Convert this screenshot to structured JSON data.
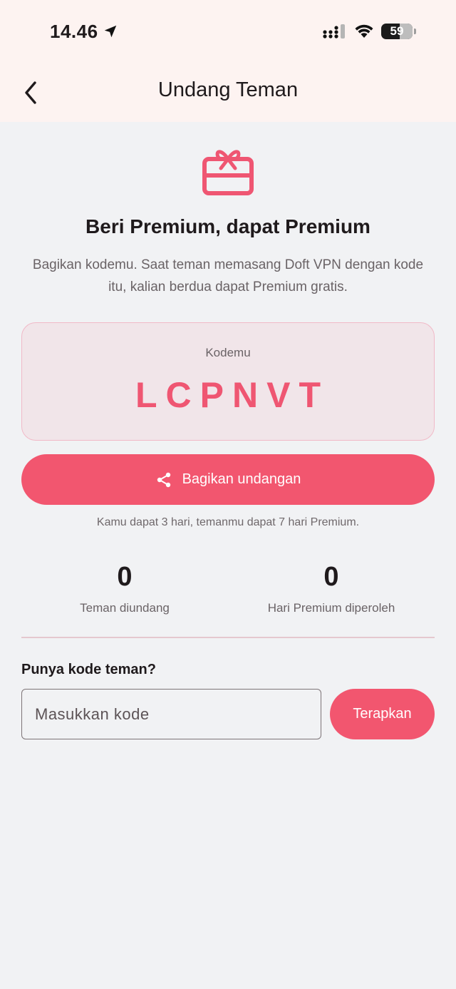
{
  "status_bar": {
    "time": "14.46",
    "battery": "59"
  },
  "header": {
    "title": "Undang Teman"
  },
  "hero": {
    "headline": "Beri Premium, dapat Premium",
    "description": "Bagikan kodemu. Saat teman memasang Doft VPN dengan kode itu, kalian berdua dapat Premium gratis."
  },
  "code_card": {
    "label": "Kodemu",
    "code": "LCPNVT"
  },
  "share": {
    "label": "Bagikan undangan"
  },
  "reward_note": "Kamu dapat 3 hari, temanmu dapat 7 hari Premium.",
  "stats": [
    {
      "value": "0",
      "label": "Teman diundang"
    },
    {
      "value": "0",
      "label": "Hari Premium diperoleh"
    }
  ],
  "friend_code": {
    "label": "Punya kode teman?",
    "placeholder": "Masukkan kode",
    "value": "",
    "apply_label": "Terapkan"
  },
  "colors": {
    "accent": "#f2566f",
    "header_bg": "#fdf3f1",
    "page_bg": "#f1f2f4",
    "card_bg": "#f1e5e9"
  }
}
